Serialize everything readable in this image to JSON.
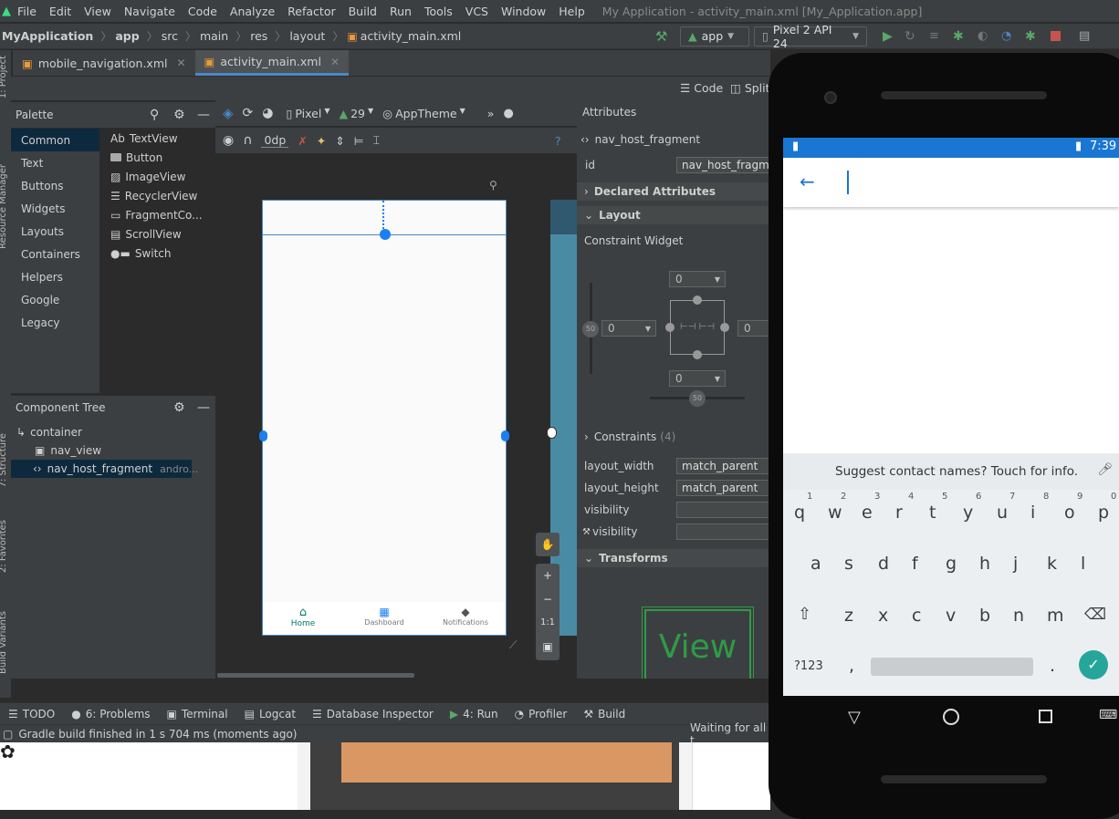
{
  "menu": {
    "items": [
      "File",
      "Edit",
      "View",
      "Navigate",
      "Code",
      "Analyze",
      "Refactor",
      "Build",
      "Run",
      "Tools",
      "VCS",
      "Window",
      "Help"
    ],
    "window_title": "My Application - activity_main.xml [My_Application.app]"
  },
  "breadcrumbs": [
    "MyApplication",
    "app",
    "src",
    "main",
    "res",
    "layout",
    "activity_main.xml"
  ],
  "run_config": {
    "module": "app",
    "device": "Pixel 2 API 24"
  },
  "editor_tabs": [
    {
      "label": "mobile_navigation.xml",
      "active": false
    },
    {
      "label": "activity_main.xml",
      "active": true
    }
  ],
  "view_modes": {
    "code": "Code",
    "split": "Split"
  },
  "left_strip": {
    "project": "1: Project",
    "resource_manager": "Resource Manager",
    "structure": "7: Structure",
    "favorites": "2: Favorites",
    "build_variants": "Build Variants"
  },
  "palette": {
    "title": "Palette",
    "categories": [
      "Common",
      "Text",
      "Buttons",
      "Widgets",
      "Layouts",
      "Containers",
      "Helpers",
      "Google",
      "Legacy"
    ],
    "selected_category": "Common",
    "items": [
      "TextView",
      "Button",
      "ImageView",
      "RecyclerView",
      "FragmentCo...",
      "ScrollView",
      "Switch"
    ],
    "textview_prefix": "Ab"
  },
  "component_tree": {
    "title": "Component Tree",
    "nodes": [
      {
        "label": "container",
        "extra": ""
      },
      {
        "label": "nav_view",
        "extra": ""
      },
      {
        "label": "nav_host_fragment",
        "extra": "andro..."
      }
    ]
  },
  "design_toolbar": {
    "device": "Pixel",
    "api": "29",
    "theme": "AppTheme",
    "margin": "0dp"
  },
  "preview": {
    "bottom_nav": [
      "Home",
      "Dashboard",
      "Notifications"
    ],
    "zoom_fit": "1:1"
  },
  "attributes": {
    "title": "Attributes",
    "component": "nav_host_fragment",
    "id_label": "id",
    "id_value": "nav_host_fragmen",
    "sections": {
      "declared": "Declared Attributes",
      "layout": "Layout",
      "constraints": "Constraints",
      "constraints_count": "(4)",
      "transforms": "Transforms"
    },
    "widget_label": "Constraint Widget",
    "margins": {
      "top": "0",
      "left": "0",
      "right": "0",
      "bottom": "0"
    },
    "bias": {
      "vertical": "50",
      "horizontal": "50"
    },
    "rows": [
      {
        "label": "layout_width",
        "value": "match_parent"
      },
      {
        "label": "layout_height",
        "value": "match_parent"
      },
      {
        "label": "visibility",
        "value": ""
      },
      {
        "label": "visibility",
        "value": ""
      }
    ],
    "transform_preview": "View"
  },
  "bottom_tools": [
    "TODO",
    "6: Problems",
    "Terminal",
    "Logcat",
    "Database Inspector",
    "4: Run",
    "Profiler",
    "Build"
  ],
  "status": {
    "message": "Gradle build finished in 1 s 704 ms (moments ago)",
    "right": "Waiting for all t"
  },
  "emulator": {
    "time": "7:39",
    "suggestion": "Suggest contact names? Touch for info.",
    "row1": [
      "q",
      "w",
      "e",
      "r",
      "t",
      "y",
      "u",
      "i",
      "o",
      "p"
    ],
    "row1_nums": [
      "1",
      "2",
      "3",
      "4",
      "5",
      "6",
      "7",
      "8",
      "9",
      "0"
    ],
    "row2": [
      "a",
      "s",
      "d",
      "f",
      "g",
      "h",
      "j",
      "k",
      "l"
    ],
    "row3": [
      "z",
      "x",
      "c",
      "v",
      "b",
      "n",
      "m"
    ],
    "sym": "?123",
    "comma": ",",
    "period": ".",
    "colors": {
      "status_bar": "#1976d2",
      "accent": "#26a69a",
      "keyboard": "#eceff1"
    }
  },
  "colors": {
    "ide_bg": "#2b2b2b",
    "panel": "#3c3f41",
    "selection": "#0d293e",
    "blueprint": "#4a8ba4"
  }
}
